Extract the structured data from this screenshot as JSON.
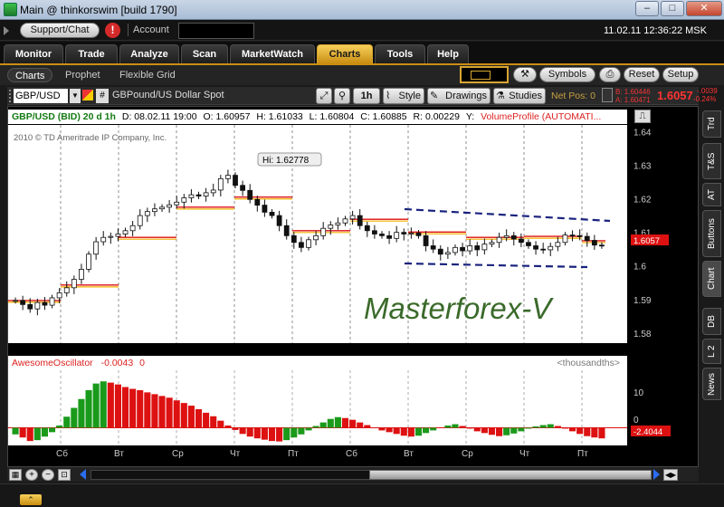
{
  "window": {
    "title": "Main @ thinkorswim [build 1790]"
  },
  "header": {
    "support_label": "Support/Chat",
    "alert_glyph": "!",
    "account_label": "Account",
    "datetime": "11.02.11 12:36:22 MSK"
  },
  "main_tabs": [
    {
      "label": "Monitor"
    },
    {
      "label": "Trade"
    },
    {
      "label": "Analyze"
    },
    {
      "label": "Scan"
    },
    {
      "label": "MarketWatch"
    },
    {
      "label": "Charts"
    },
    {
      "label": "Tools"
    },
    {
      "label": "Help"
    }
  ],
  "sub_tabs": [
    {
      "label": "Charts"
    },
    {
      "label": "Prophet"
    },
    {
      "label": "Flexible Grid"
    }
  ],
  "toolbar": {
    "symbols_label": "Symbols",
    "reset_label": "Reset",
    "setup_label": "Setup"
  },
  "chart_toolbar": {
    "symbol": "GBP/USD",
    "description": "GBPound/US Dollar Spot",
    "timeframe": "1h",
    "style_label": "Style",
    "drawings_label": "Drawings",
    "studies_label": "Studies",
    "net_pos": "Net Pos: 0",
    "bid": "B: 1.60446",
    "ask": "A: 1.60471",
    "last": "1.6057",
    "change": "-.0039",
    "change_pct": "-0.24%"
  },
  "infobar": {
    "symbol": "GBP/USD (BID) 20 d 1h",
    "date": "D: 08.02.11 19:00",
    "open": "O: 1.60957",
    "high": "H: 1.61033",
    "low": "L: 1.60804",
    "close": "C: 1.60885",
    "range": "R: 0.00229",
    "y": "Y:",
    "study": "VolumeProfile (AUTOMATI..."
  },
  "chart": {
    "copyright": "2010 © TD Ameritrade IP Company, Inc.",
    "hi_label": "Hi: 1.62778",
    "watermark": "Masterforex-V",
    "y_ticks": [
      "1.64",
      "1.63",
      "1.62",
      "1.61",
      "1.6",
      "1.59",
      "1.58"
    ],
    "price_tag": "1.6057"
  },
  "oscillator": {
    "name": "AwesomeOscillator",
    "value": "-0.0043",
    "extra": "0",
    "units": "<thousandths>",
    "y_ticks": [
      "10",
      "0"
    ],
    "value_tag": "-2.4044"
  },
  "x_axis": {
    "labels": [
      "Сб",
      "Вт",
      "Ср",
      "Чт",
      "Пт",
      "Сб",
      "Вт",
      "Ср",
      "Чт",
      "Пт"
    ]
  },
  "side_tabs": [
    {
      "label": "Trd"
    },
    {
      "label": "T&S"
    },
    {
      "label": "AT"
    },
    {
      "label": "Buttons"
    },
    {
      "label": "Chart"
    },
    {
      "label": "DB"
    },
    {
      "label": "L 2"
    },
    {
      "label": "News"
    }
  ],
  "chart_data": {
    "type": "line",
    "x": [
      "Сб",
      "Вт",
      "Ср",
      "Чт",
      "Пт",
      "Сб",
      "Вт",
      "Ср",
      "Чт",
      "Пт"
    ],
    "series": [],
    "closes": [
      1.5897,
      1.5885,
      1.5872,
      1.5891,
      1.5883,
      1.5905,
      1.592,
      1.5935,
      1.596,
      1.599,
      1.6035,
      1.6072,
      1.6085,
      1.6088,
      1.6095,
      1.6105,
      1.612,
      1.615,
      1.6162,
      1.617,
      1.6175,
      1.6182,
      1.619,
      1.6203,
      1.6212,
      1.6208,
      1.6218,
      1.6226,
      1.626,
      1.627,
      1.624,
      1.6225,
      1.6198,
      1.6181,
      1.616,
      1.615,
      1.612,
      1.609,
      1.607,
      1.6055,
      1.6078,
      1.609,
      1.6112,
      1.6122,
      1.6128,
      1.614,
      1.615,
      1.612,
      1.6105,
      1.6095,
      1.609,
      1.6082,
      1.61,
      1.6095,
      1.6098,
      1.609,
      1.606,
      1.605,
      1.6035,
      1.604,
      1.6055,
      1.6045,
      1.606,
      1.6048,
      1.6065,
      1.607,
      1.6085,
      1.609,
      1.608,
      1.607,
      1.606,
      1.605,
      1.6048,
      1.6058,
      1.607,
      1.6092,
      1.609,
      1.6088,
      1.6076,
      1.6062,
      1.606
    ],
    "ylim": [
      1.577,
      1.642
    ],
    "hi": 1.62778,
    "osc": [
      -1.5,
      -2.2,
      -3.0,
      -2.8,
      -2.0,
      -1.0,
      0.5,
      2.5,
      4.5,
      6.5,
      8.5,
      10.0,
      10.5,
      10.2,
      9.8,
      9.2,
      8.8,
      8.5,
      8.0,
      7.6,
      7.2,
      6.8,
      6.2,
      5.6,
      5.0,
      4.2,
      3.4,
      2.6,
      1.6,
      0.5,
      -0.5,
      -1.4,
      -2.0,
      -2.4,
      -2.7,
      -3.0,
      -3.1,
      -2.8,
      -2.2,
      -1.5,
      -0.6,
      0.4,
      1.2,
      2.0,
      2.4,
      2.2,
      1.8,
      1.2,
      0.6,
      0.0,
      -0.6,
      -1.0,
      -1.4,
      -1.8,
      -2.0,
      -1.8,
      -1.2,
      -0.6,
      0.0,
      0.5,
      0.8,
      0.4,
      -0.2,
      -0.8,
      -1.2,
      -1.6,
      -1.9,
      -1.7,
      -1.3,
      -0.8,
      -0.2,
      0.3,
      0.6,
      0.8,
      0.4,
      -0.2,
      -0.8,
      -1.4,
      -1.9,
      -2.2,
      -2.4
    ],
    "osc_ylim": [
      -4,
      13
    ]
  }
}
